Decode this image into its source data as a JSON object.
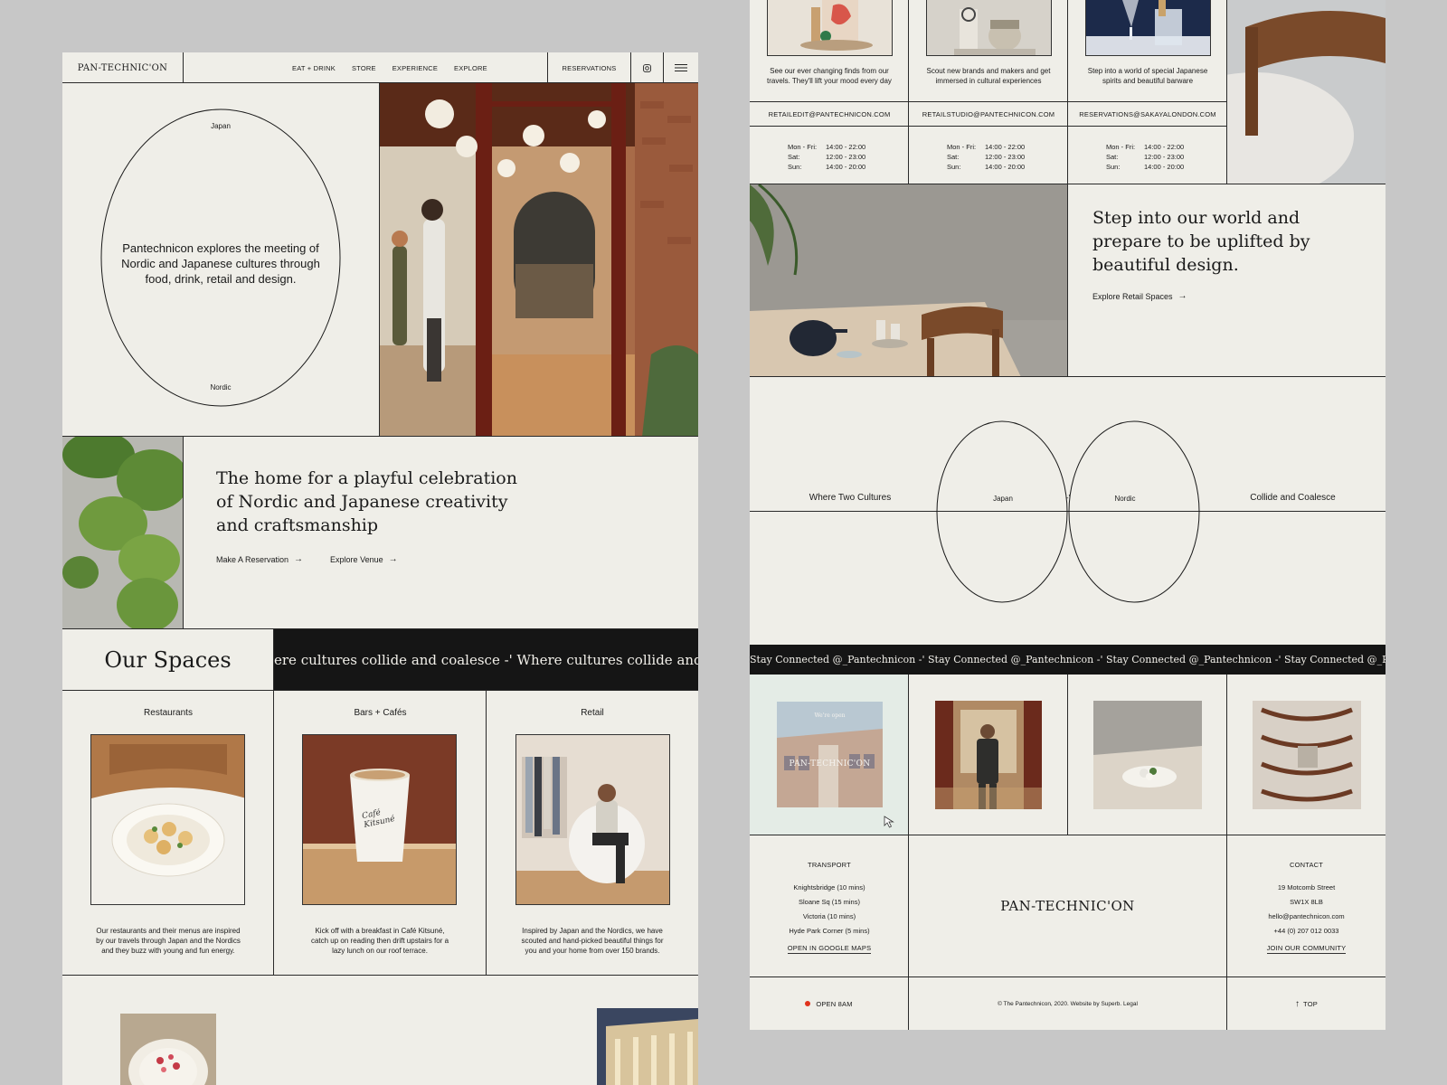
{
  "brand": "PAN-TECHNIC'ON",
  "nav": {
    "items": [
      "EAT + DRINK",
      "STORE",
      "EXPERIENCE",
      "EXPLORE"
    ],
    "reservations": "RESERVATIONS"
  },
  "hero": {
    "top_label": "Japan",
    "bottom_label": "Nordic",
    "text": "Pantechnicon explores the meeting of Nordic and Japanese cultures through food, drink, retail and design."
  },
  "intro": {
    "heading": "The home for a playful celebration of Nordic and Japanese creativity and craftsmanship",
    "links": [
      "Make A Reservation",
      "Explore Venue"
    ]
  },
  "spaces": {
    "title": "Our Spaces",
    "marquee": "ere cultures collide and coalesce  -'  Where cultures collide and coalesce",
    "columns": [
      {
        "label": "Restaurants",
        "text": "Our restaurants and their menus are inspired by our travels through Japan and the Nordics and they buzz with young and fun energy."
      },
      {
        "label": "Bars + Cafés",
        "text": "Kick off with a breakfast in Café Kitsuné, catch up on reading then drift upstairs for a lazy lunch on our roof terrace."
      },
      {
        "label": "Retail",
        "text": "Inspired by Japan and the Nordics, we have scouted and hand-picked beautiful things for you and your home from over 150 brands."
      }
    ],
    "cup_text": "Café Kitsuné"
  },
  "stores": [
    {
      "text": "See our ever changing finds from our travels. They'll lift your mood every day",
      "email": "RETAILEDIT@PANTECHNICON.COM",
      "hours": [
        [
          "Mon - Fri:",
          "14:00 - 22:00"
        ],
        [
          "Sat:",
          "12:00 - 23:00"
        ],
        [
          "Sun:",
          "14:00 - 20:00"
        ]
      ]
    },
    {
      "text": "Scout new brands and makers and get immersed in cultural experiences",
      "email": "RETAILSTUDIO@PANTECHNICON.COM",
      "hours": [
        [
          "Mon - Fri:",
          "14:00 - 22:00"
        ],
        [
          "Sat:",
          "12:00 - 23:00"
        ],
        [
          "Sun:",
          "14:00 - 20:00"
        ]
      ]
    },
    {
      "text": "Step into a world of special Japanese spirits and beautiful barware",
      "email": "RESERVATIONS@SAKAYALONDON.COM",
      "hours": [
        [
          "Mon - Fri:",
          "14:00 - 22:00"
        ],
        [
          "Sat:",
          "12:00 - 23:00"
        ],
        [
          "Sun:",
          "14:00 - 20:00"
        ]
      ]
    }
  ],
  "world": {
    "heading": "Step into our world and prepare to be uplifted by beautiful design.",
    "link": "Explore Retail Spaces"
  },
  "venn": {
    "left": "Where Two Cultures",
    "japan": "Japan",
    "mid": "-'",
    "nordic": "Nordic",
    "right": "Collide and Coalesce"
  },
  "social": {
    "marquee": "Stay Connected @_Pantechnicon  -'  Stay Connected @_Pantechnicon  -'  Stay Connected @_Pantechnicon  -'  Stay Connected @_Pantechnicon",
    "post_overlay_top": "We're open",
    "post_overlay_brand": "PAN-TECHNIC'ON"
  },
  "footer": {
    "transport_title": "TRANSPORT",
    "transport": [
      "Knightsbridge (10 mins)",
      "Sloane Sq (15 mins)",
      "Victoria (10 mins)",
      "Hyde Park Corner (5 mins)"
    ],
    "maps_link": "OPEN IN GOOGLE MAPS",
    "brand": "PAN-TECHNIC'ON",
    "contact_title": "CONTACT",
    "contact": [
      "19 Motcomb Street",
      "SW1X 8LB",
      "hello@pantechnicon.com",
      "+44 (0) 207 012 0033"
    ],
    "community_link": "JOIN OUR COMMUNITY",
    "status": "OPEN 8AM",
    "copyright": "© The Pantechnicon, 2020. Website by Superb. Legal",
    "top": "TOP"
  },
  "colors": {
    "accent_dot": "#e0321c",
    "dark": "#151515",
    "page_bg": "#efeee8"
  }
}
